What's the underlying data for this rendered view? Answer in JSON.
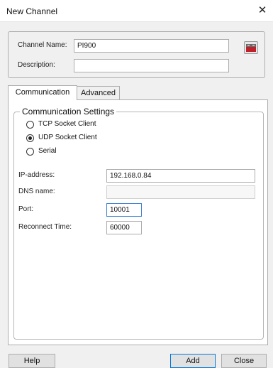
{
  "window": {
    "title": "New Channel",
    "close_glyph": "✕"
  },
  "channel": {
    "name_label": "Channel Name:",
    "name_value": "PI900",
    "description_label": "Description:",
    "description_value": "",
    "icon": "channel-device-icon"
  },
  "tabs": [
    {
      "label": "Communication",
      "active": true
    },
    {
      "label": "Advanced",
      "active": false
    }
  ],
  "communication": {
    "legend": "Communication Settings",
    "options": [
      {
        "label": "TCP Socket Client",
        "checked": false
      },
      {
        "label": "UDP Socket Client",
        "checked": true
      },
      {
        "label": "Serial",
        "checked": false
      }
    ],
    "ip_label": "IP-address:",
    "ip_value": "192.168.0.84",
    "dns_label": "DNS name:",
    "dns_value": "",
    "port_label": "Port:",
    "port_value": "10001",
    "reconnect_label": "Reconnect Time:",
    "reconnect_value": "60000"
  },
  "buttons": {
    "help": "Help",
    "add": "Add",
    "close": "Close"
  },
  "colors": {
    "focus": "#3c7fd0",
    "default_button_border": "#0078d7",
    "icon_red": "#c0202a"
  }
}
